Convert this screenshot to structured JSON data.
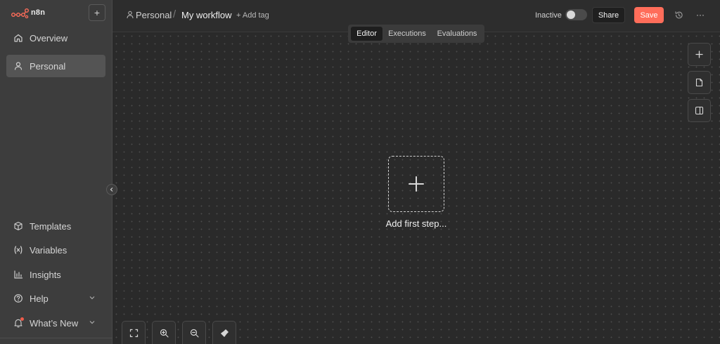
{
  "app": {
    "name": "n8n",
    "accent": "#ff6d5a"
  },
  "sidebar": {
    "add_label": "+",
    "top_items": [
      {
        "label": "Overview",
        "icon": "home-icon"
      },
      {
        "label": "Personal",
        "icon": "user-icon",
        "active": true
      }
    ],
    "bottom_items": [
      {
        "label": "Templates",
        "icon": "box-icon"
      },
      {
        "label": "Variables",
        "icon": "variables-icon"
      },
      {
        "label": "Insights",
        "icon": "chart-icon"
      },
      {
        "label": "Help",
        "icon": "help-icon",
        "expandable": true
      },
      {
        "label": "What’s New",
        "icon": "bell-icon",
        "expandable": true,
        "notification": true
      }
    ]
  },
  "header": {
    "project": "Personal",
    "separator": "/",
    "workflow_title": "My workflow",
    "add_tag": "+ Add tag",
    "status": "Inactive",
    "share_label": "Share",
    "save_label": "Save",
    "more_label": "···"
  },
  "tabs": [
    {
      "label": "Editor",
      "active": true
    },
    {
      "label": "Executions"
    },
    {
      "label": "Evaluations"
    }
  ],
  "canvas": {
    "add_first_step": "Add first step..."
  }
}
